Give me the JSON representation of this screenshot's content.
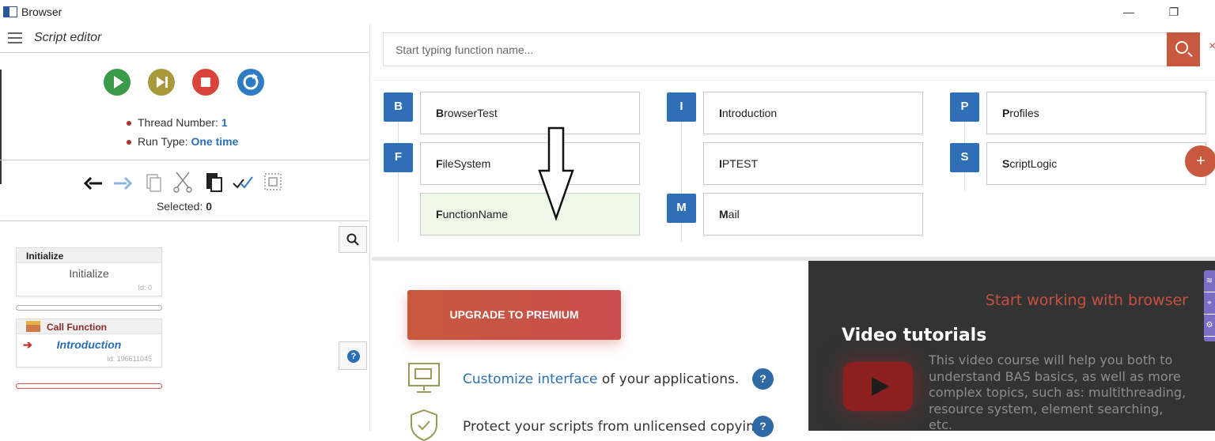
{
  "window": {
    "title": "Browser",
    "minimize": "—",
    "restore": "❐"
  },
  "editor": {
    "title": "Script editor",
    "thread_label": "Thread Number:",
    "thread_value": "1",
    "runtype_label": "Run Type:",
    "runtype_value": "One time",
    "selected_label": "Selected:",
    "selected_value": "0",
    "controls": [
      {
        "name": "play-icon",
        "glyph": "▶",
        "color": "#3d9a4a"
      },
      {
        "name": "step-icon",
        "glyph": "▶|",
        "color": "#a89a3a"
      },
      {
        "name": "stop-icon",
        "glyph": "■",
        "color": "#d9453a"
      },
      {
        "name": "restart-icon",
        "glyph": "⟳",
        "color": "#2e7bc4"
      }
    ],
    "nodes": {
      "initialize": {
        "header": "Initialize",
        "body": "Initialize",
        "id": "Id: 0"
      },
      "call": {
        "header": "Call Function",
        "body": "Introduction",
        "id": "Id: 196611045"
      }
    }
  },
  "search": {
    "placeholder": "Start typing function name...",
    "close": "×"
  },
  "functions": {
    "groups": [
      {
        "letter": "B"
      },
      {
        "letter": "F"
      },
      {
        "letter": "I"
      },
      {
        "letter": "M"
      },
      {
        "letter": "P"
      },
      {
        "letter": "S"
      }
    ],
    "items": [
      {
        "first": "B",
        "rest": "rowserTest"
      },
      {
        "first": "F",
        "rest": "ileSystem"
      },
      {
        "first": "F",
        "rest": "unctionName"
      },
      {
        "first": "I",
        "rest": "ntroduction"
      },
      {
        "first": "I",
        "rest": "PTEST"
      },
      {
        "first": "M",
        "rest": "ail"
      },
      {
        "first": "P",
        "rest": "rofiles"
      },
      {
        "first": "S",
        "rest": "criptLogic"
      }
    ],
    "add": "+"
  },
  "promo": {
    "premium": "UPGRADE TO PREMIUM",
    "feature1_link": "Customize interface",
    "feature1_rest": " of your applications.",
    "feature2": "Protect your scripts from unlicensed copying.",
    "help": "?"
  },
  "video": {
    "start": "Start working with browser",
    "title": "Video tutorials",
    "desc": "This video course will help you both to understand BAS basics, as well as more complex topics, such as: multithreading, resource system, element searching, etc."
  }
}
